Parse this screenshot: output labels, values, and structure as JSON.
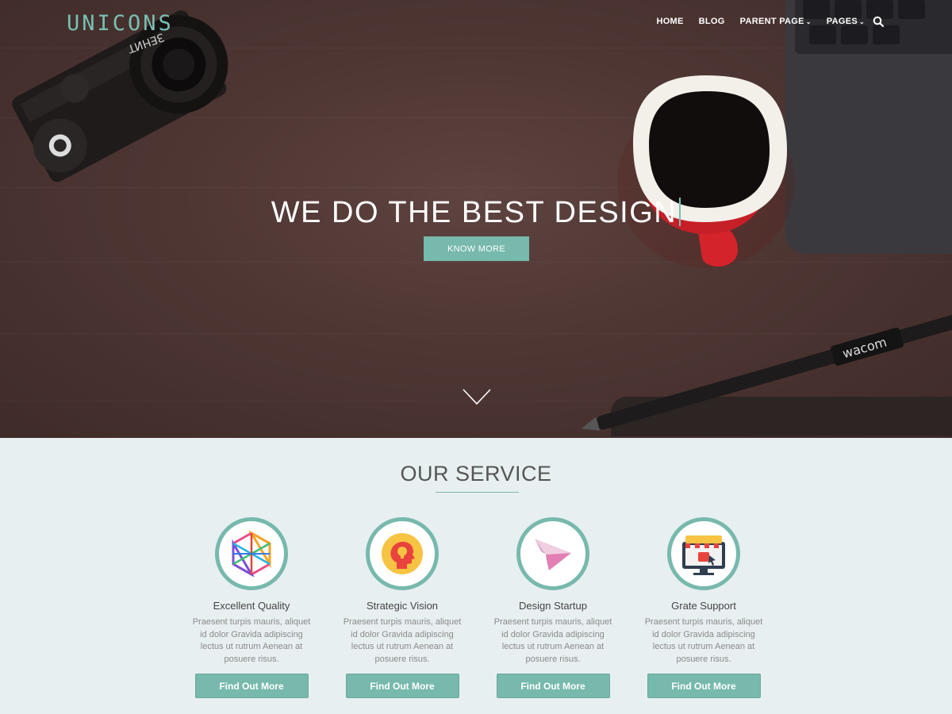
{
  "brand": {
    "logo_text": "UNICONS",
    "accent": "#77b9ac"
  },
  "nav": {
    "items": [
      {
        "label": "HOME"
      },
      {
        "label": "BLOG"
      },
      {
        "label": "PARENT PAGE"
      },
      {
        "label": "PAGES"
      }
    ],
    "search_icon": "search-icon"
  },
  "hero": {
    "headline": "WE DO THE BEST DESIGN",
    "cta_label": "KNOW MORE",
    "scroll_icon": "chevron-down-icon",
    "decor_text": {
      "camera_brand": "ЗЕНИТ",
      "pen_brand": "wacom"
    }
  },
  "services": {
    "title": "OUR SERVICE",
    "cards": [
      {
        "title": "Excellent Quality",
        "description": "Praesent turpis mauris, aliquet id dolor Gravida adipiscing lectus ut rutrum Aenean at posuere risus.",
        "button": "Find Out More",
        "icon": "geodesic-hexagon-icon"
      },
      {
        "title": "Strategic Vision",
        "description": "Praesent turpis mauris, aliquet id dolor Gravida adipiscing lectus ut rutrum Aenean at posuere risus.",
        "button": "Find Out More",
        "icon": "head-lightbulb-icon"
      },
      {
        "title": "Design Startup",
        "description": "Praesent turpis mauris, aliquet id dolor Gravida adipiscing lectus ut rutrum Aenean at posuere risus.",
        "button": "Find Out More",
        "icon": "paper-plane-icon"
      },
      {
        "title": "Grate Support",
        "description": "Praesent turpis mauris, aliquet id dolor Gravida adipiscing lectus ut rutrum Aenean at posuere risus.",
        "button": "Find Out More",
        "icon": "storefront-monitor-icon"
      }
    ]
  }
}
